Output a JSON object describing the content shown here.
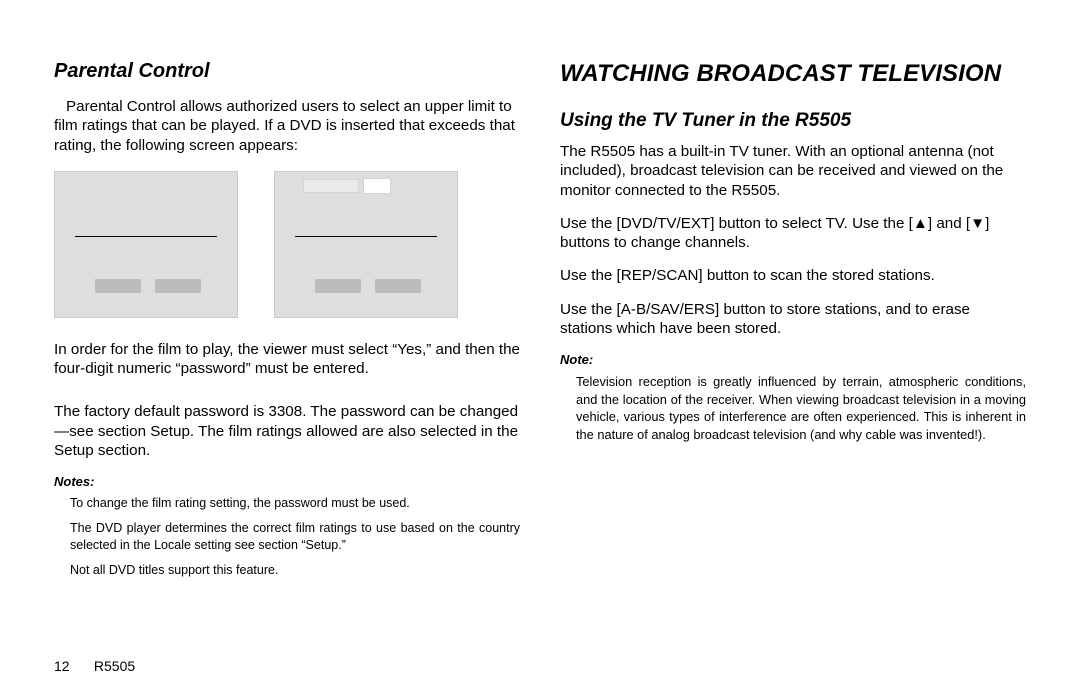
{
  "left": {
    "heading": "Parental Control",
    "p1": "Parental Control allows authorized users to select an upper limit to film ratings that can be played. If a DVD is inserted that exceeds that rating, the following screen appears:",
    "p2": "In order for the film to play, the viewer must select “Yes,” and then the four-digit numeric “password” must be entered.",
    "p3": "The factory default password is 3308. The password can be changed—see section Setup. The film ratings allowed are also selected in the Setup section.",
    "notes_label": "Notes:",
    "note1": "To change the film rating setting, the password must be used.",
    "note2": "The DVD player determines the correct film ratings to use based on the country selected in the Locale setting see section “Setup.”",
    "note3": "Not all DVD titles support this feature."
  },
  "right": {
    "main_heading": "WATCHING BROADCAST TELEVISION",
    "sub_heading": "Using the TV Tuner in the R5505",
    "p1": "The R5505 has a built-in TV tuner. With an optional antenna (not included), broadcast television can be received and viewed on the monitor connected to the R5505.",
    "p2_a": "Use the [DVD/TV/EXT] button to select TV. Use the [",
    "p2_b": "] and [",
    "p2_c": "] buttons to change channels.",
    "p3": "Use the [REP/SCAN] button to scan the stored stations.",
    "p4": "Use the [A-B/SAV/ERS] button to store stations, and to erase stations which have been stored.",
    "note_label": "Note:",
    "note1": "Television reception is greatly influenced by terrain, atmospheric conditions, and the location of the receiver. When viewing broadcast television in a moving vehicle, various types of interference are often experienced. This is inherent in the nature of analog broadcast television (and why cable was invented!)."
  },
  "footer": {
    "page": "12",
    "model": "R5505"
  },
  "glyphs": {
    "up": "▲",
    "down": "▼"
  }
}
